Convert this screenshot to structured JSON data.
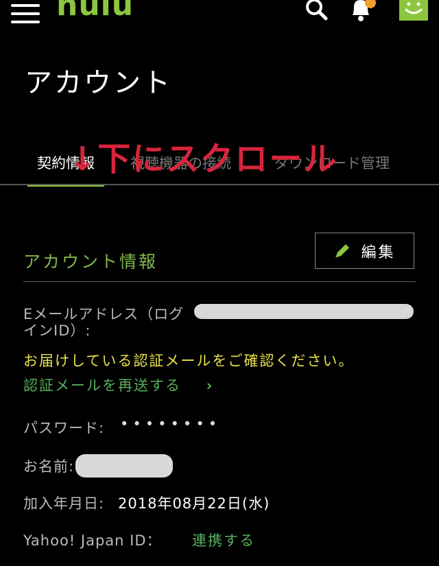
{
  "colors": {
    "background": "#000000",
    "brand_green": "#8cc63f",
    "text_green": "#7fb74a",
    "link_green": "#58b05c",
    "notice_yellow": "#e9e148",
    "annotation_red": "#d8243c",
    "badge_orange": "#f59e2a"
  },
  "header": {
    "logo_text": "hulu",
    "icons": [
      "menu-icon",
      "search-icon",
      "bell-icon",
      "avatar-smiley-icon"
    ]
  },
  "page": {
    "title": "アカウント"
  },
  "tabs": [
    {
      "label": "契約情報",
      "active": true
    },
    {
      "label": "視聴機器の接続",
      "active": false
    },
    {
      "label": "ダウンロード管理",
      "active": false
    }
  ],
  "annotation": {
    "text": "↓下にスクロール"
  },
  "account_info": {
    "section_title": "アカウント情報",
    "edit_label": "編集",
    "email_label": "Eメールアドレス（ログインID）:",
    "verify_notice": "お届けしている認証メールをご確認ください。",
    "resend_link": "認証メールを再送する",
    "resend_chevron": "›",
    "password_label": "パスワード:",
    "password_value": "••••••••",
    "name_label": "お名前:",
    "join_date_label": "加入年月日:",
    "join_date_value": "2018年08月22日(水)",
    "yahoo_label": "Yahoo! Japan ID：",
    "yahoo_link": "連携する"
  }
}
